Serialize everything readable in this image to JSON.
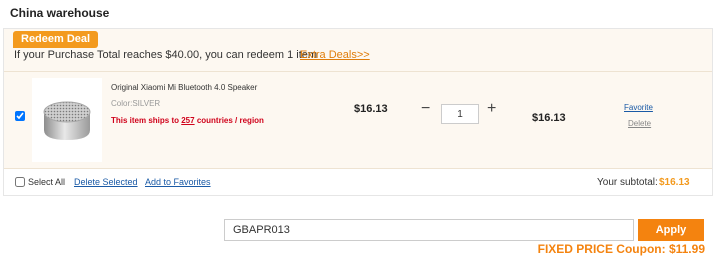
{
  "warehouse": {
    "title": "China warehouse"
  },
  "promo": {
    "badge": "Redeem Deal",
    "text": "If your Purchase Total reaches $40.00, you can redeem 1 item",
    "extra_link": "Extra Deals>>"
  },
  "item": {
    "checked": true,
    "name": "Original Xiaomi Mi Bluetooth 4.0 Speaker",
    "color_label": "Color:SILVER",
    "ships_prefix": "This item ships to ",
    "ships_count": "257",
    "ships_suffix": " countries / region",
    "unit_price": "$16.13",
    "qty_minus": "−",
    "quantity": "1",
    "qty_plus": "+",
    "line_total": "$16.13",
    "favorite": "Favorite",
    "delete": "Delete"
  },
  "footer": {
    "select_all": "Select All",
    "delete_selected": "Delete Selected",
    "add_to_favorites": "Add to Favorites",
    "subtotal_label": "Your subtotal:",
    "subtotal_value": "$16.13"
  },
  "coupon": {
    "code": "GBAPR013",
    "apply_label": "Apply",
    "status": "FIXED PRICE Coupon: $11.99"
  },
  "colors": {
    "accent": "#f39a1e",
    "link": "#1a5aa6",
    "alert": "#d0021b"
  }
}
